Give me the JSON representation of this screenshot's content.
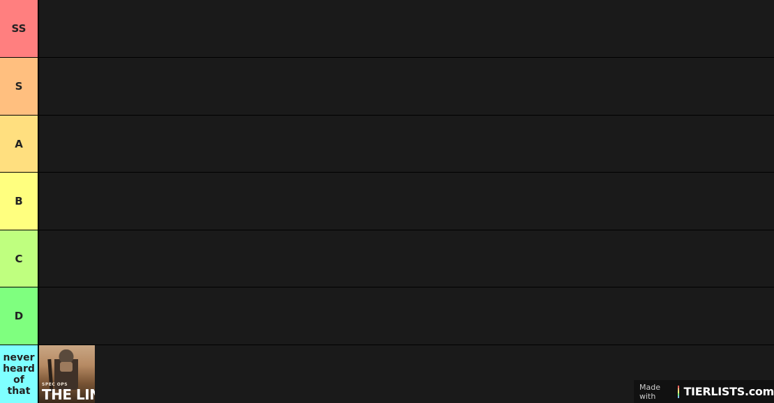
{
  "tiers": [
    {
      "label": "SS",
      "color": "#ff7f7f",
      "items": []
    },
    {
      "label": "S",
      "color": "#ffbf7f",
      "items": []
    },
    {
      "label": "A",
      "color": "#ffdf7f",
      "items": []
    },
    {
      "label": "B",
      "color": "#ffff7f",
      "items": []
    },
    {
      "label": "C",
      "color": "#bfff7f",
      "items": []
    },
    {
      "label": "D",
      "color": "#7fff7f",
      "items": []
    },
    {
      "label": "never heard of that",
      "lines": [
        "never",
        "heard",
        "of",
        "that"
      ],
      "color": "#7fffff",
      "items": [
        {
          "name": "spec-ops-the-line",
          "cover_sub": "SPEC OPS",
          "cover_main": "THE LIN"
        }
      ]
    }
  ],
  "watermark": {
    "made_with": "Made with",
    "brand": "TIERLISTS.com"
  },
  "colors": {
    "background": "#000000",
    "row_area": "#1a1a1a"
  }
}
